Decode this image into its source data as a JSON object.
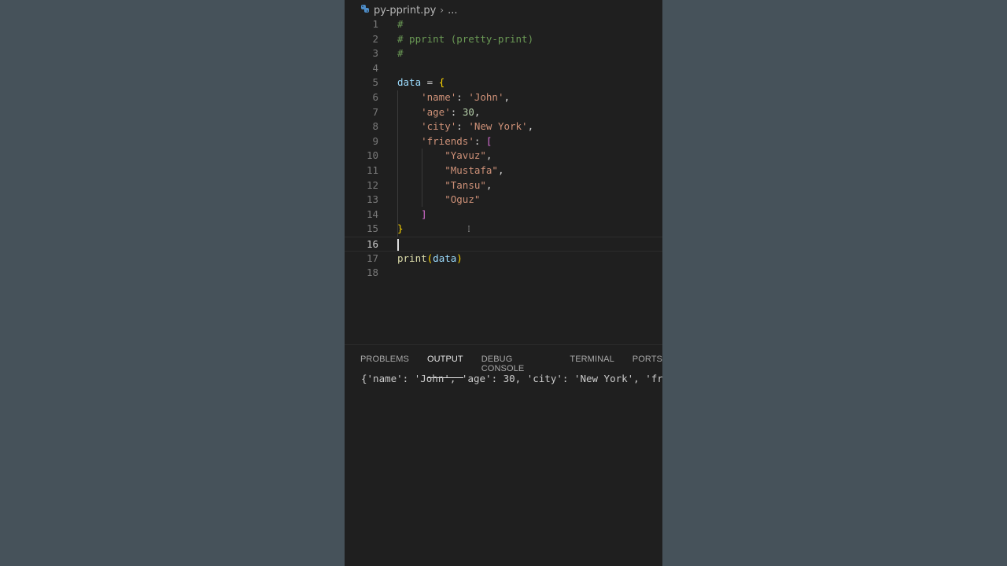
{
  "breadcrumb": {
    "file_name": "py-pprint.py",
    "separator": "›",
    "more": "..."
  },
  "editor": {
    "active_line": 16,
    "lines": [
      {
        "num": "1",
        "text": "#"
      },
      {
        "num": "2",
        "text": "# pprint (pretty-print)"
      },
      {
        "num": "3",
        "text": "#"
      },
      {
        "num": "4",
        "text": ""
      },
      {
        "num": "5",
        "text": "data = {"
      },
      {
        "num": "6",
        "text": "    'name': 'John',"
      },
      {
        "num": "7",
        "text": "    'age': 30,"
      },
      {
        "num": "8",
        "text": "    'city': 'New York',"
      },
      {
        "num": "9",
        "text": "    'friends': ["
      },
      {
        "num": "10",
        "text": "        \"Yavuz\","
      },
      {
        "num": "11",
        "text": "        \"Mustafa\","
      },
      {
        "num": "12",
        "text": "        \"Tansu\","
      },
      {
        "num": "13",
        "text": "        \"Oguz\""
      },
      {
        "num": "14",
        "text": "    ]"
      },
      {
        "num": "15",
        "text": "}"
      },
      {
        "num": "16",
        "text": ""
      },
      {
        "num": "17",
        "text": "print(data)"
      },
      {
        "num": "18",
        "text": ""
      }
    ]
  },
  "panel": {
    "tabs": [
      {
        "label": "PROBLEMS",
        "active": false
      },
      {
        "label": "OUTPUT",
        "active": true
      },
      {
        "label": "DEBUG CONSOLE",
        "active": false
      },
      {
        "label": "TERMINAL",
        "active": false
      },
      {
        "label": "PORTS",
        "active": false
      }
    ],
    "output": "{'name': 'John', 'age': 30, 'city': 'New York', 'fr"
  },
  "colors": {
    "background": "#46525a",
    "editor_bg": "#1f1f1f",
    "comment": "#6a9955",
    "variable": "#9cdcfe",
    "string": "#ce9178",
    "number": "#b5cea8",
    "function": "#dcdcaa",
    "brace": "#ffd700",
    "bracket": "#da70d6"
  }
}
